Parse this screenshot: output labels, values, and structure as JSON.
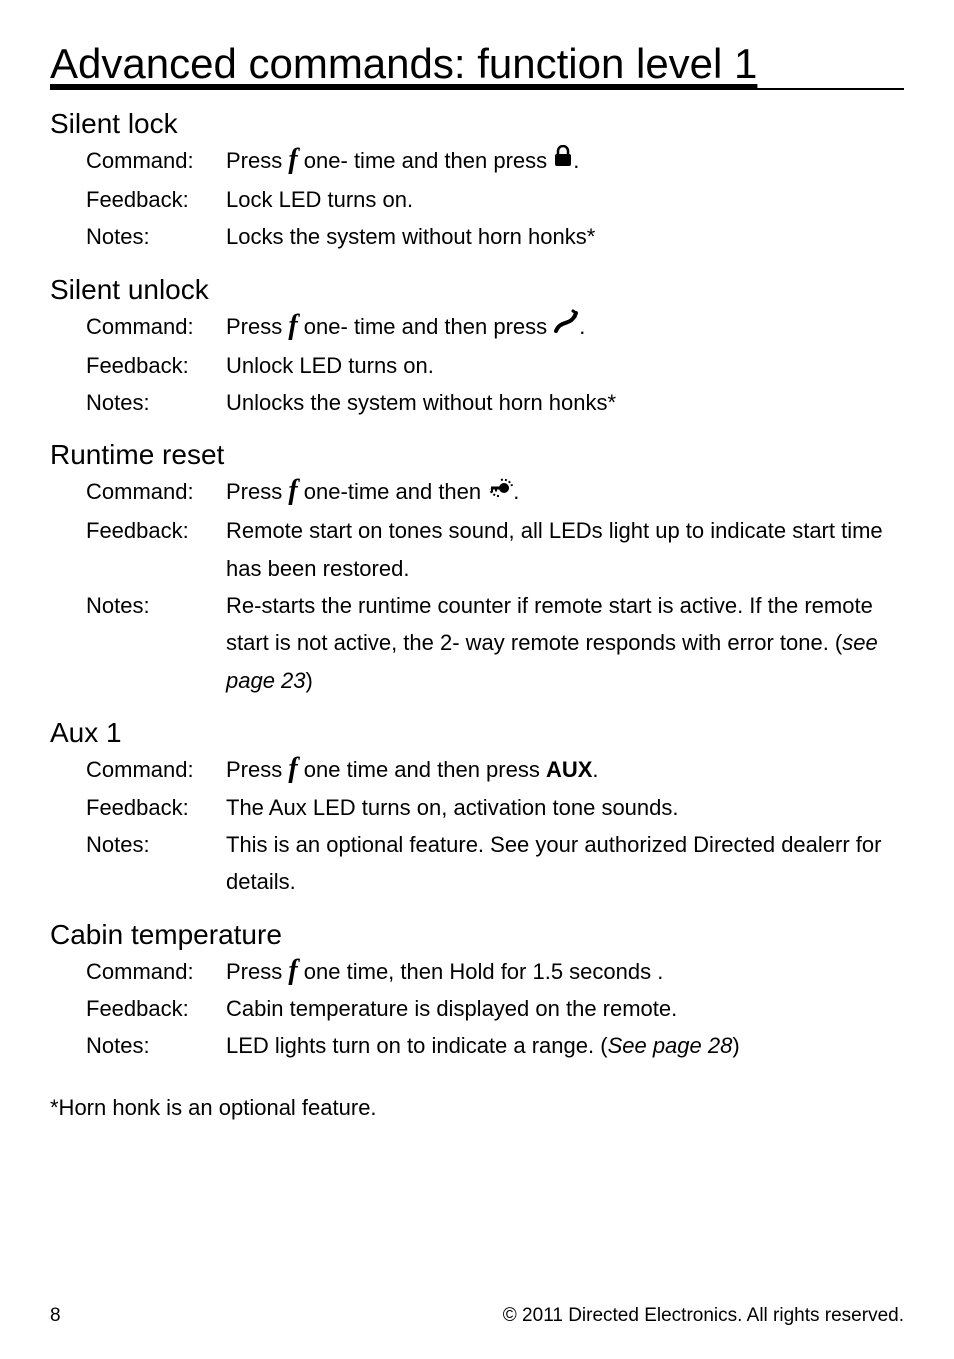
{
  "page_title": "Advanced commands: function level 1",
  "labels": {
    "command": "Command",
    "feedback": "Feedback:",
    "notes": "Notes"
  },
  "sections": [
    {
      "title": "Silent lock",
      "command_prefix": "Press ",
      "command_mid": " one- time and then press ",
      "command_suffix": ".",
      "icon1": "f",
      "icon2": "lock",
      "feedback": "Lock LED turns on.",
      "notes": "Locks the system without horn honks*"
    },
    {
      "title": "Silent unlock",
      "command_prefix": "Press ",
      "command_mid": "  one- time and then press  ",
      "command_suffix": ".",
      "icon1": "f",
      "icon2": "unlock",
      "feedback": "Unlock LED turns on.",
      "notes": "Unlocks the system without horn honks*"
    },
    {
      "title": "Runtime reset",
      "command_prefix": "Press  ",
      "command_mid": " one-time and then ",
      "command_suffix": ".",
      "icon1": "f",
      "icon2": "key",
      "feedback": "Remote start on tones sound, all LEDs light up to indicate start time has been restored.",
      "notes_pre": "Re-starts the runtime counter if remote start is active. If the remote start is not active, the 2- way remote responds with error tone.  (",
      "notes_ref": "see page 23",
      "notes_post": ")"
    },
    {
      "title": "Aux 1",
      "command_prefix": "Press  ",
      "command_mid": " one time and then press ",
      "command_aux": "AUX",
      "command_suffix": ".",
      "icon1": "f",
      "feedback": "The Aux LED turns on, activation tone sounds.",
      "notes": "This is an optional feature. See your authorized Directed dealerr for details."
    },
    {
      "title": "Cabin temperature",
      "command_prefix": "Press  ",
      "command_mid": " one time, then Hold for 1.5 seconds .",
      "icon1": "f",
      "feedback": "Cabin temperature is displayed on the remote.",
      "notes_pre": "LED lights turn on to indicate a range. (",
      "notes_ref": "See page 28",
      "notes_post": ")"
    }
  ],
  "footnote": "*Horn honk is an optional feature.",
  "footer": {
    "page_num": "8",
    "copyright": "© 2011 Directed Electronics. All rights reserved."
  }
}
